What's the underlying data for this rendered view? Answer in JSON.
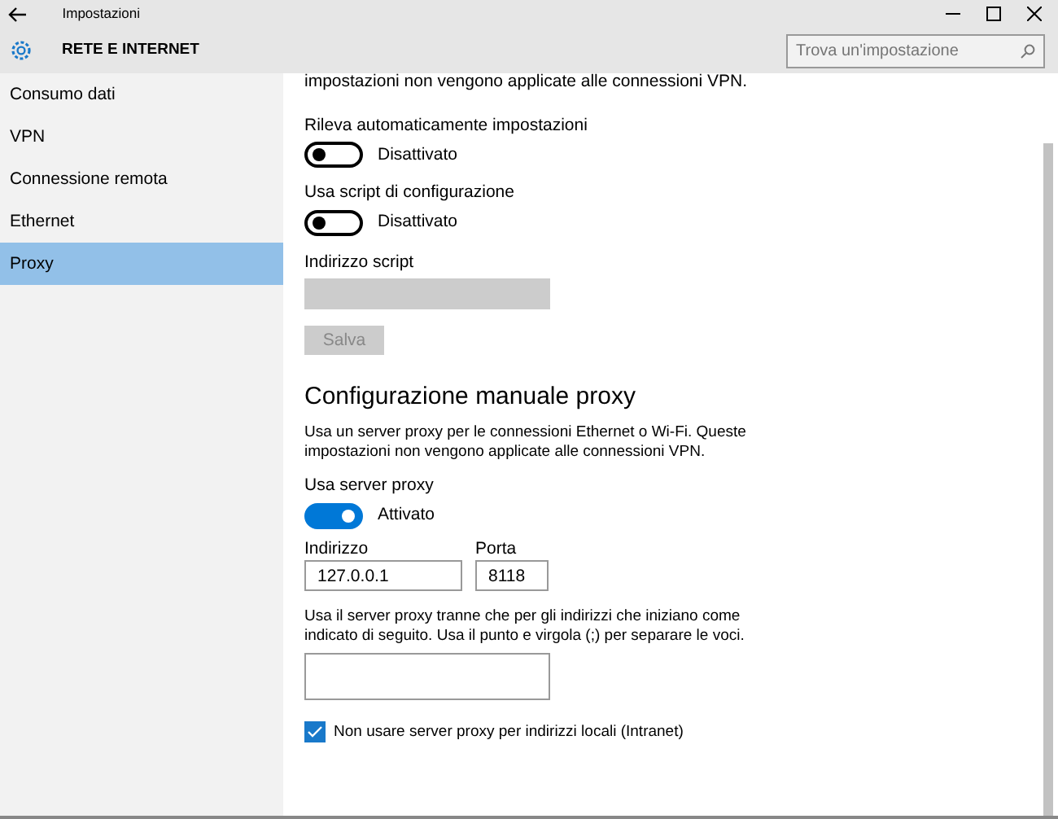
{
  "window": {
    "title": "Impostazioni"
  },
  "header": {
    "title": "RETE E INTERNET",
    "search_placeholder": "Trova un'impostazione"
  },
  "sidebar": {
    "items": [
      {
        "label": "Consumo dati",
        "selected": false
      },
      {
        "label": "VPN",
        "selected": false
      },
      {
        "label": "Connessione remota",
        "selected": false
      },
      {
        "label": "Ethernet",
        "selected": false
      },
      {
        "label": "Proxy",
        "selected": true
      }
    ]
  },
  "automatic": {
    "description": "impostazioni non vengono applicate alle connessioni VPN.",
    "toggles": [
      {
        "label": "Rileva automaticamente impostazioni",
        "state_text": "Disattivato",
        "on": false
      },
      {
        "label": "Usa script di configurazione",
        "state_text": "Disattivato",
        "on": false
      }
    ],
    "script_field": {
      "label": "Indirizzo script",
      "disabled": true
    },
    "save_button": {
      "label": "Salva",
      "disabled": true
    }
  },
  "manual": {
    "heading": "Configurazione manuale proxy",
    "description": "Usa un server proxy per le connessioni Ethernet o Wi-Fi. Queste impostazioni non vengono applicate alle connessioni VPN.",
    "toggle": {
      "label": "Usa server proxy",
      "state_text": "Attivato",
      "on": true
    },
    "address": {
      "label": "Indirizzo",
      "value": "127.0.0.1"
    },
    "port": {
      "label": "Porta",
      "value": "8118"
    },
    "exceptions": {
      "description": "Usa il server proxy tranne che per gli indirizzi che iniziano come indicato di seguito. Usa il punto e virgola (;) per separare le voci."
    },
    "local_checkbox": {
      "label": "Non usare server proxy per indirizzi locali (Intranet)",
      "checked": true
    }
  }
}
